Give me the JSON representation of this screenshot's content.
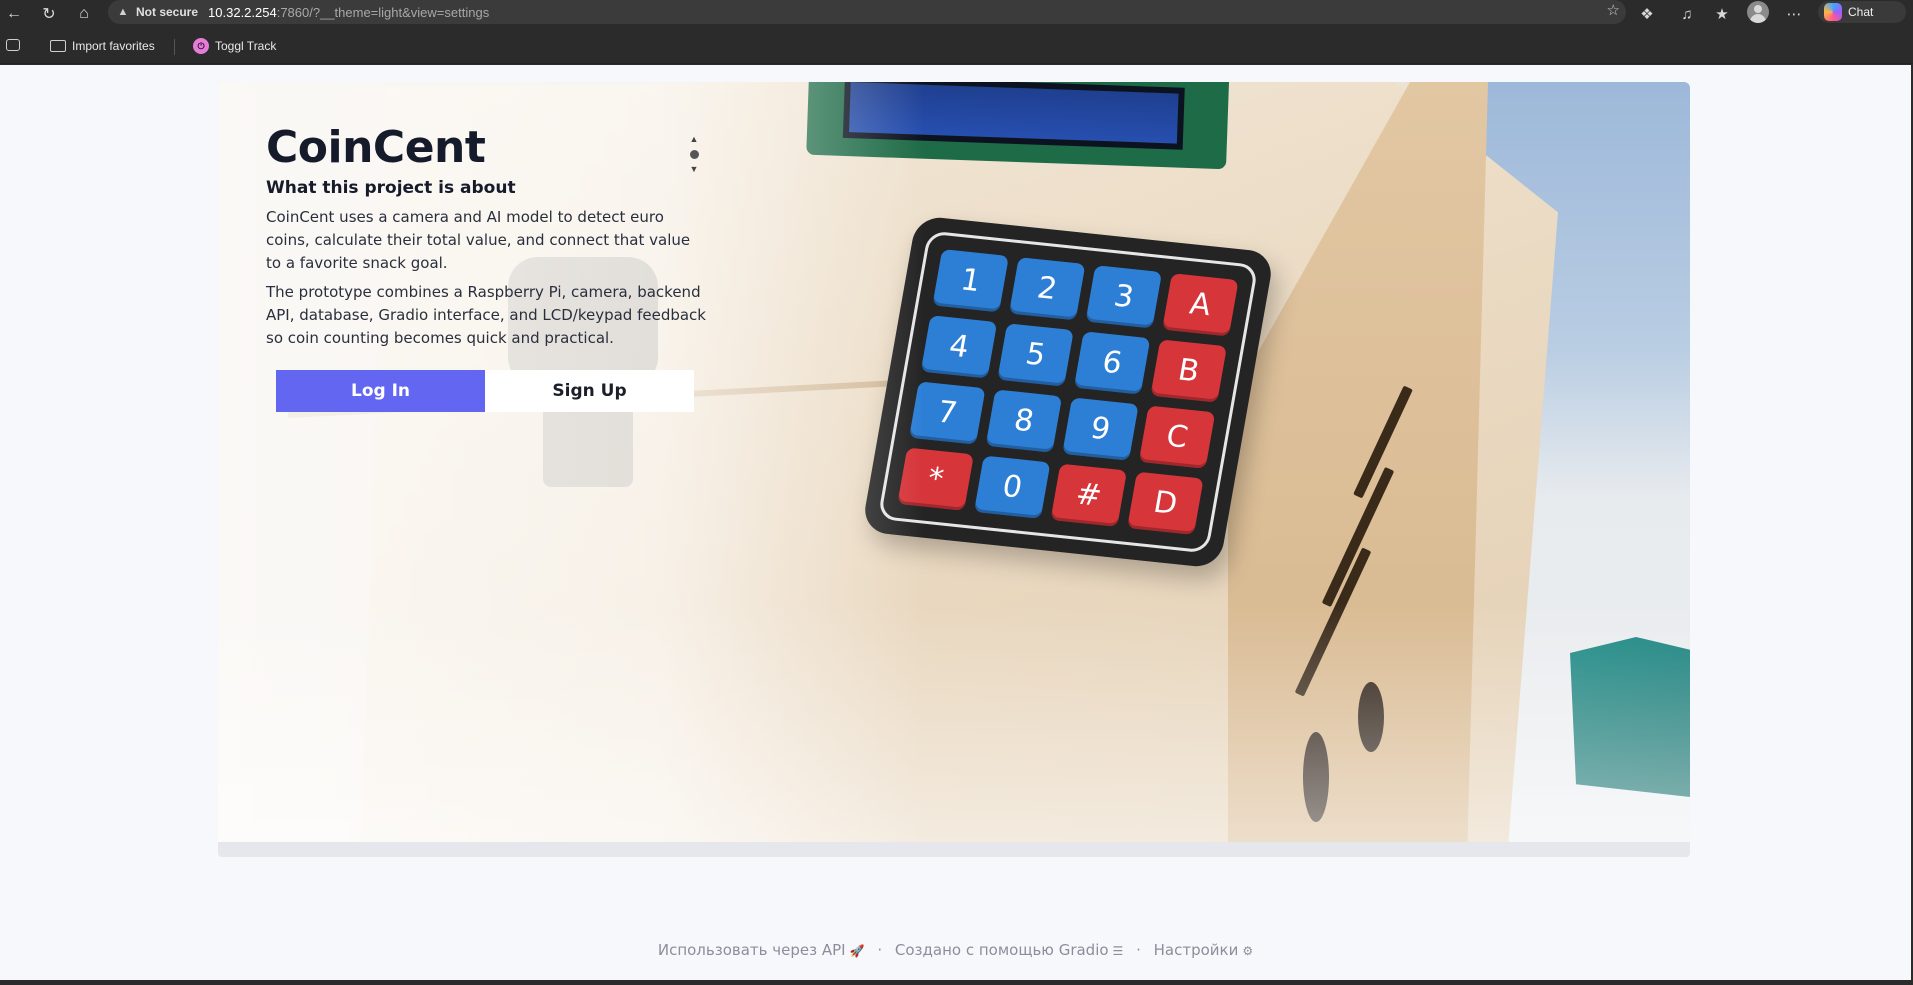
{
  "browser": {
    "security_label": "Not secure",
    "url_host": "10.32.2.254",
    "url_rest": ":7860/?__theme=light&view=settings",
    "chat_label": "Chat",
    "bookmarks": [
      {
        "label": "Import favorites"
      },
      {
        "label": "Toggl Track"
      }
    ]
  },
  "hero": {
    "title": "CoinCent",
    "subtitle": "What this project is about",
    "paragraphs": [
      "CoinCent uses a camera and AI model to detect euro coins, calculate their total value, and connect that value to a favorite snack goal.",
      "The prototype combines a Raspberry Pi, camera, backend API, database, Gradio interface, and LCD/keypad feedback so coin counting becomes quick and practical."
    ],
    "login_label": "Log In",
    "signup_label": "Sign Up",
    "keypad_keys": [
      "1",
      "2",
      "3",
      "A",
      "4",
      "5",
      "6",
      "B",
      "7",
      "8",
      "9",
      "C",
      "*",
      "0",
      "#",
      "D"
    ]
  },
  "footer": {
    "api_label": "Использовать через API",
    "gradio_label": "Создано с помощью Gradio",
    "settings_label": "Настройки",
    "separator": "·"
  }
}
